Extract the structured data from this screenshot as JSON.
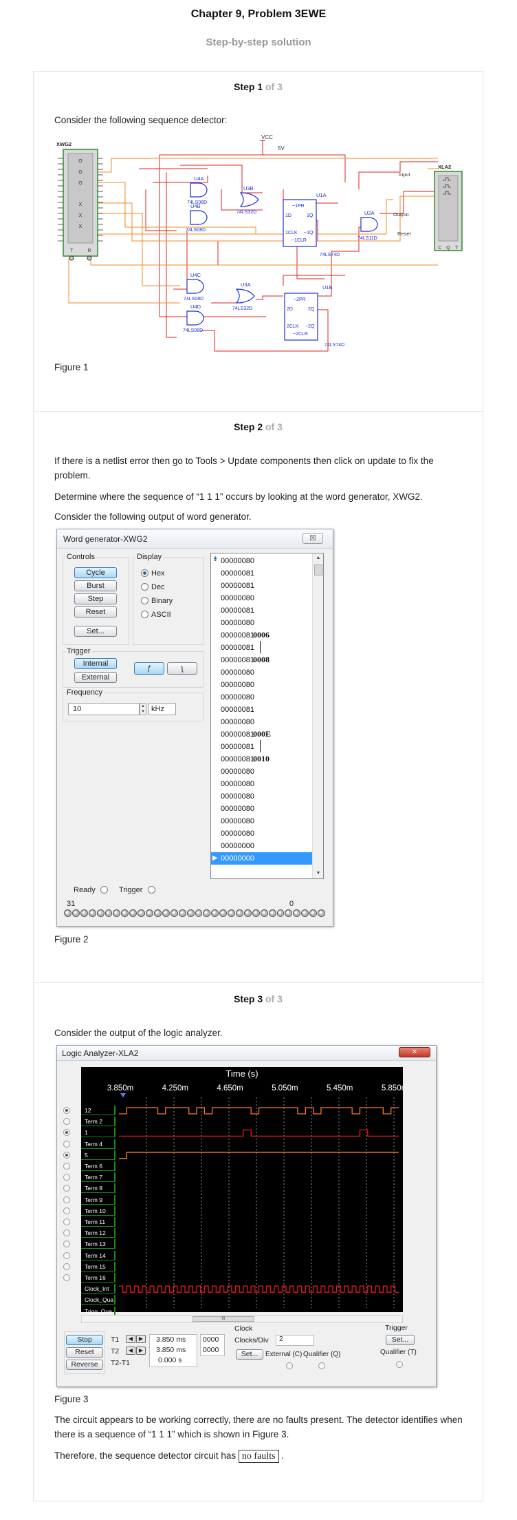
{
  "header": {
    "title": "Chapter 9, Problem 3EWE",
    "subtitle": "Step-by-step solution"
  },
  "steps": [
    {
      "label": "Step 1",
      "of": "of 3",
      "text": "Consider the following sequence detector:",
      "figure": "Figure 1"
    },
    {
      "label": "Step 2",
      "of": "of 3",
      "p1": "If there is a netlist error then go to Tools > Update components then click on update to fix the problem.",
      "p2": "Determine where the sequence of “1 1 1” occurs by looking at the word generator, XWG2.",
      "p3": "Consider the following output of word generator.",
      "figure": "Figure 2"
    },
    {
      "label": "Step 3",
      "of": "of 3",
      "p1": "Consider the output of the logic analyzer.",
      "figure": "Figure 3",
      "p2": "The circuit appears to be working correctly, there are no faults present. The detector identifies when there is a sequence of “1 1 1” which is shown in Figure 3.",
      "p3_prefix": "Therefore, the sequence detector circuit has",
      "p3_answer": "no faults",
      "p3_suffix": "."
    }
  ],
  "circuit": {
    "vcc": "VCC",
    "supply": "5V",
    "xwg": "XWG2",
    "xla": "XLA2",
    "gates": [
      "U4A",
      "74LS08D",
      "U4B",
      "74LS08D",
      "U3B",
      "74LS32D",
      "U1A",
      "U2A",
      "74LS11D",
      "U4C",
      "74LS08D",
      "U3A",
      "74LS32D",
      "U4D",
      "74LS08D",
      "U1B",
      "74LS74D",
      "74LS74D"
    ],
    "ff1_pins": [
      "~1PR",
      "1D",
      "1Q",
      "1CLK",
      "~1Q",
      "~1CLR"
    ],
    "ff2_pins": [
      "~2PR",
      "2D",
      "2Q",
      "2CLK",
      "~2Q",
      "~2CLR"
    ],
    "labels": {
      "input": "Input",
      "output": "Output",
      "reset": "Reset"
    },
    "xwg_pins": [
      "T",
      "R"
    ],
    "xla_pins": [
      "C",
      "Q",
      "T"
    ],
    "xwg_markers": [
      "O",
      "O",
      "O",
      "X",
      "X",
      "X"
    ],
    "colors": {
      "wire_red": "#e0201b",
      "wire_orange": "#f08a24",
      "gate_blue": "#1e2fd4",
      "instrument_green": "#2e8b2e"
    }
  },
  "word_generator": {
    "title": "Word generator-XWG2",
    "close_glyph": "☒",
    "controls": {
      "group": "Controls",
      "cycle": "Cycle",
      "burst": "Burst",
      "step": "Step",
      "reset": "Reset",
      "set": "Set..."
    },
    "display": {
      "group": "Display",
      "options": [
        "Hex",
        "Dec",
        "Binary",
        "ASCII"
      ],
      "selected": "Hex"
    },
    "trigger": {
      "group": "Trigger",
      "internal": "Internal",
      "external": "External",
      "rising": "ƒ",
      "falling": "ʅ"
    },
    "frequency": {
      "group": "Frequency",
      "value": "10",
      "unit": "kHz"
    },
    "words": [
      "00000080",
      "00000081",
      "00000081",
      "00000080",
      "00000081",
      "00000080",
      "00000081",
      "00000081",
      "00000081",
      "00000080",
      "00000080",
      "00000080",
      "00000081",
      "00000080",
      "00000081",
      "00000081",
      "00000081",
      "00000080",
      "00000080",
      "00000080",
      "00000080",
      "00000080",
      "00000080",
      "00000000",
      "00000000"
    ],
    "annotations": [
      {
        "text": "0006",
        "row": 6
      },
      {
        "text": "0008",
        "row": 8
      },
      {
        "text": "000E",
        "row": 14
      },
      {
        "text": "0010",
        "row": 16
      }
    ],
    "status": {
      "ready": "Ready",
      "trigger": "Trigger"
    },
    "bit_range": {
      "left": "31",
      "right": "0"
    }
  },
  "logic_analyzer": {
    "title": "Logic Analyzer-XLA2",
    "close_glyph": "✕",
    "time_label": "Time (s)",
    "time_ticks": [
      "3.850m",
      "4.250m",
      "4.650m",
      "5.050m",
      "5.450m",
      "5.850m"
    ],
    "channels": [
      "12",
      "Term 2",
      "1",
      "Term 4",
      "5",
      "Term 6",
      "Term 7",
      "Term 8",
      "Term 9",
      "Term 10",
      "Term 11",
      "Term 12",
      "Term 13",
      "Term 14",
      "Term 15",
      "Term 16",
      "Clock_Int",
      "Clock_Qua",
      "Trigg_Qua"
    ],
    "active_channels": [
      0,
      2,
      4
    ],
    "buttons": {
      "stop": "Stop",
      "reset": "Reset",
      "reverse": "Reverse"
    },
    "cursor": {
      "t1": "T1",
      "t2": "T2",
      "t2_t1": "T2-T1",
      "t1_val": "3.850 ms",
      "t2_val": "3.850 ms",
      "diff_val": "0.000 s",
      "t1_bits": "0000",
      "t2_bits": "0000"
    },
    "clock": {
      "group": "Clock",
      "per_div_label": "Clocks/Div",
      "per_div_value": "2",
      "set": "Set...",
      "external": "External (C)",
      "qualifier": "Qualifier (Q)"
    },
    "trigger": {
      "group": "Trigger",
      "set": "Set...",
      "qualifier": "Qualifier (T)"
    },
    "scroll_glyph": "III",
    "trace_colors": {
      "ch12": "#ff7a1a",
      "ch1": "#e5191b",
      "ch5": "#ff8a1a",
      "clock": "#e5191b"
    }
  }
}
